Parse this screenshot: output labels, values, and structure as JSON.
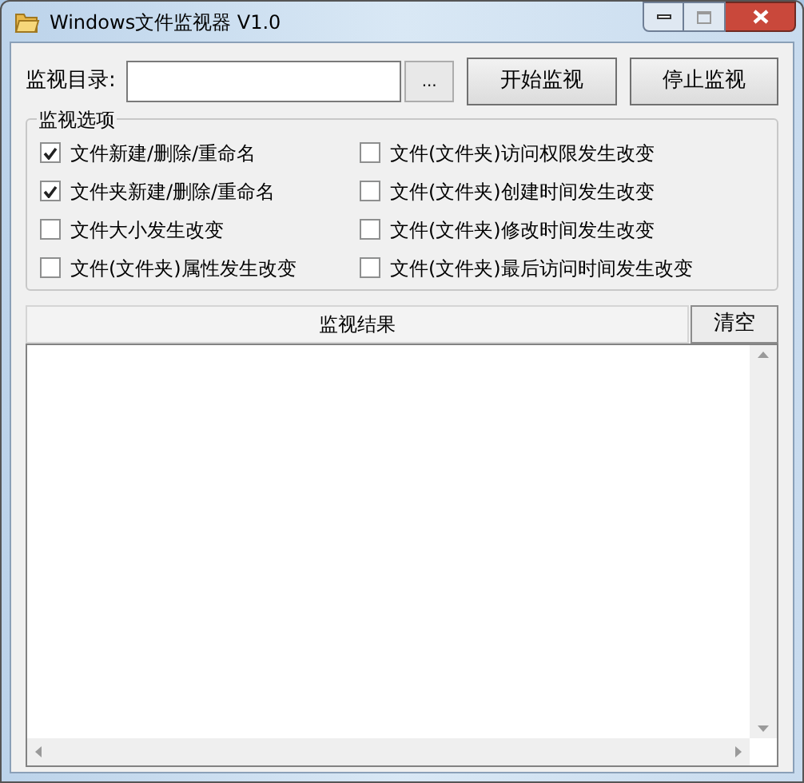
{
  "window": {
    "title": "Windows文件监视器 V1.0"
  },
  "directory": {
    "label": "监视目录:",
    "browse_button": "..."
  },
  "buttons": [
    "开始监视",
    "停止监视"
  ],
  "options_group": {
    "title": "监视选项",
    "options": [
      {
        "label": "文件新建/删除/重命名",
        "checked": true
      },
      {
        "label": "文件(文件夹)访问权限发生改变",
        "checked": false
      },
      {
        "label": "文件夹新建/删除/重命名",
        "checked": true
      },
      {
        "label": "文件(文件夹)创建时间发生改变",
        "checked": false
      },
      {
        "label": "文件大小发生改变",
        "checked": false
      },
      {
        "label": "文件(文件夹)修改时间发生改变",
        "checked": false
      },
      {
        "label": "文件(文件夹)属性发生改变",
        "checked": false
      },
      {
        "label": "文件(文件夹)最后访问时间发生改变",
        "checked": false
      }
    ]
  },
  "results": {
    "header": "监视结果",
    "clear_button": "清空"
  }
}
